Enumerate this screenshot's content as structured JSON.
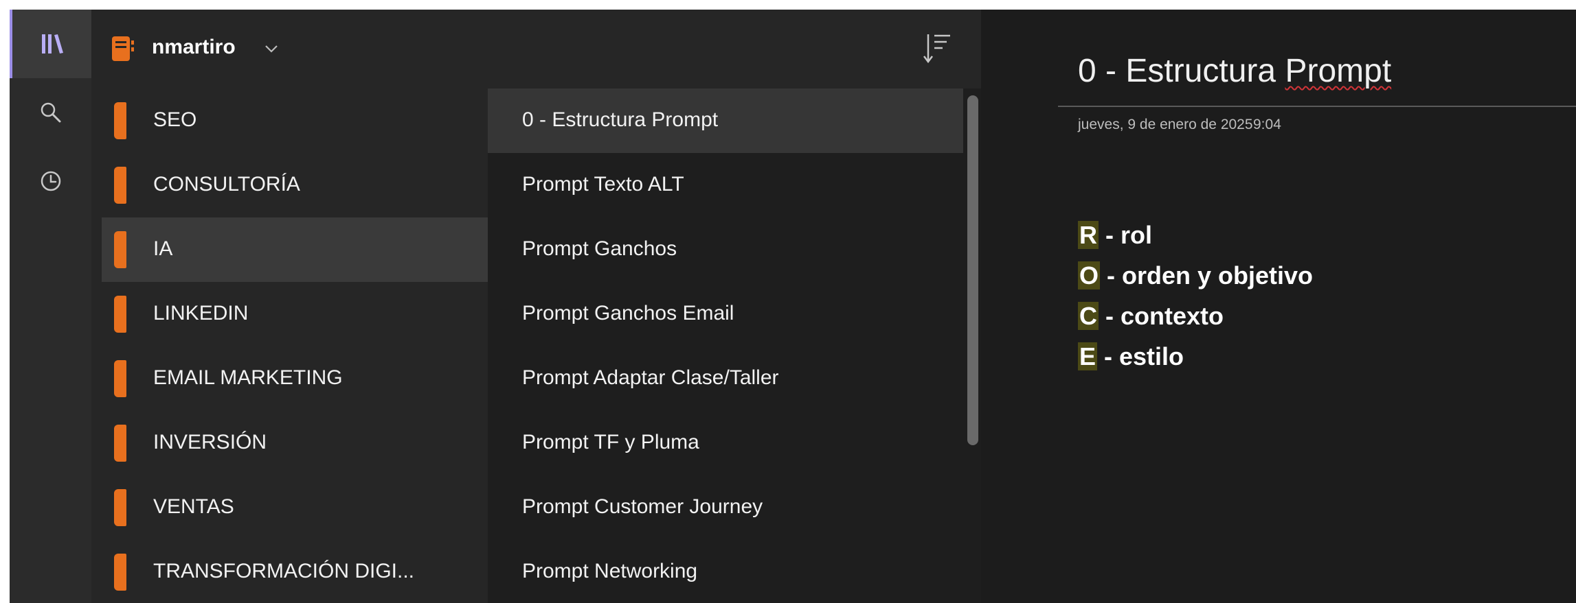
{
  "header": {
    "notebook_name": "nmartiro"
  },
  "sections": [
    {
      "label": "SEO"
    },
    {
      "label": "CONSULTORÍA"
    },
    {
      "label": "IA",
      "selected": true
    },
    {
      "label": "LINKEDIN"
    },
    {
      "label": "EMAIL MARKETING"
    },
    {
      "label": "INVERSIÓN"
    },
    {
      "label": "VENTAS"
    },
    {
      "label": "TRANSFORMACIÓN DIGI..."
    }
  ],
  "pages": [
    {
      "label": "0 - Estructura Prompt",
      "selected": true
    },
    {
      "label": "Prompt Texto ALT"
    },
    {
      "label": "Prompt Ganchos"
    },
    {
      "label": "Prompt Ganchos Email"
    },
    {
      "label": "Prompt Adaptar Clase/Taller"
    },
    {
      "label": "Prompt TF y Pluma"
    },
    {
      "label": "Prompt Customer Journey"
    },
    {
      "label": "Prompt Networking"
    }
  ],
  "note": {
    "title_part1": "0 - Estructura ",
    "title_part2": "Prompt",
    "date": "jueves, 9 de enero de 2025",
    "time": "9:04",
    "lines": [
      {
        "letter": "R",
        "rest": " - rol"
      },
      {
        "letter": "O",
        "rest": " - orden y objetivo"
      },
      {
        "letter": "C",
        "rest": " - contexto"
      },
      {
        "letter": "E",
        "rest": " - estilo"
      }
    ]
  },
  "icons": {
    "library": "library-icon",
    "search": "search-icon",
    "recent": "clock-icon",
    "notebook": "notebook-icon",
    "chevron": "chevron-down-icon",
    "sort": "sort-icon"
  },
  "colors": {
    "accent_rail": "#9b8ee8",
    "section_tab": "#e8701e",
    "notebook_icon": "#e8701e",
    "highlight": "#4c4a16",
    "spellcheck": "#d13438"
  }
}
